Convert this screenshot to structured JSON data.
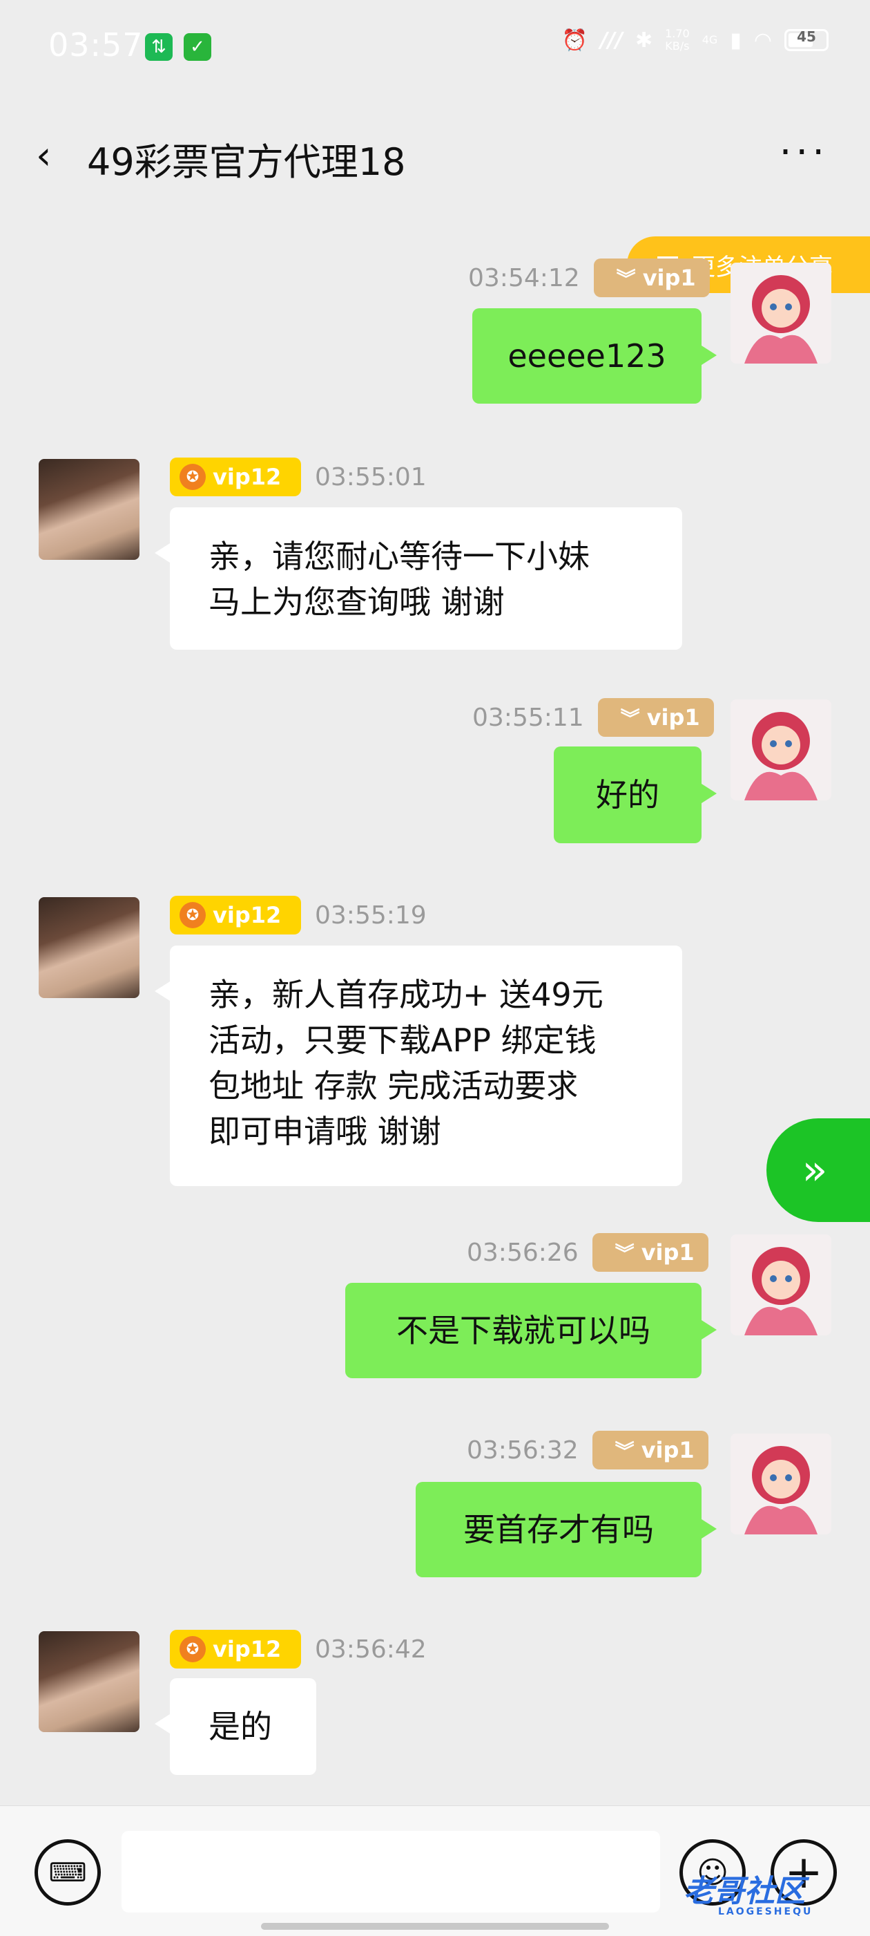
{
  "status_bar": {
    "time": "03:57",
    "speed": "1.70",
    "speed_unit": "KB/s",
    "network": "4G",
    "battery": "45"
  },
  "header": {
    "back_icon": "chevron-left-icon",
    "title": "49彩票官方代理18",
    "more_label": "···"
  },
  "share_button": {
    "label": "更多注单分享",
    "icon": "list-icon"
  },
  "messages": [
    {
      "side": "right",
      "time": "03:54:12",
      "badge": "vip1",
      "text": "eeeee123"
    },
    {
      "side": "left",
      "time": "03:55:01",
      "badge": "vip12",
      "lines": [
        "亲，请您耐心等待一下小妹",
        "马上为您查询哦 谢谢"
      ]
    },
    {
      "side": "right",
      "time": "03:55:11",
      "badge": "vip1",
      "text": "好的"
    },
    {
      "side": "left",
      "time": "03:55:19",
      "badge": "vip12",
      "lines": [
        "亲，新人首存成功+ 送49元",
        "活动，只要下载APP 绑定钱",
        "包地址 存款 完成活动要求",
        "即可申请哦 谢谢"
      ]
    },
    {
      "side": "right",
      "time": "03:56:26",
      "badge": "vip1",
      "text": "不是下载就可以吗"
    },
    {
      "side": "right",
      "time": "03:56:32",
      "badge": "vip1",
      "text": "要首存才有吗"
    },
    {
      "side": "left",
      "time": "03:56:42",
      "badge": "vip12",
      "text": "是的"
    }
  ],
  "composer": {
    "keyboard_icon": "keyboard-icon",
    "emoji_icon": "emoji-icon",
    "plus_icon": "plus-icon",
    "input_value": ""
  },
  "watermark": {
    "text": "老哥社区",
    "sub": "LAOGESHEQU"
  },
  "colors": {
    "background": "#ededed",
    "self_bubble": "#7ded58",
    "other_bubble": "#ffffff",
    "vip12_badge": "#ffd400",
    "vip1_badge": "#e0b77c",
    "share_pill": "#ffc21a",
    "fab": "#1cc426"
  }
}
